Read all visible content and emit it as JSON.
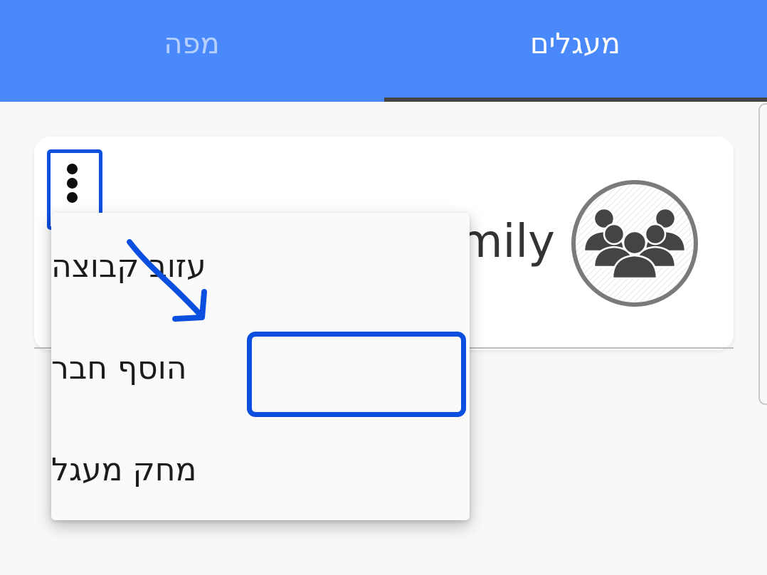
{
  "tabs": {
    "circles_label": "מעגלים",
    "map_label": "מפה",
    "active": "circles"
  },
  "card": {
    "group_name": "mily",
    "avatar_icon": "group-people-icon",
    "more_icon": "more-vertical-icon"
  },
  "menu": {
    "items": [
      {
        "label": "עזוב קבוצה"
      },
      {
        "label": "הוסף חבר"
      },
      {
        "label": "מחק מעגל"
      }
    ]
  },
  "colors": {
    "tab_bar": "#4a89fb",
    "tab_indicator": "#444444",
    "annotation": "#0a4fe0",
    "background": "#f8f8f8"
  }
}
